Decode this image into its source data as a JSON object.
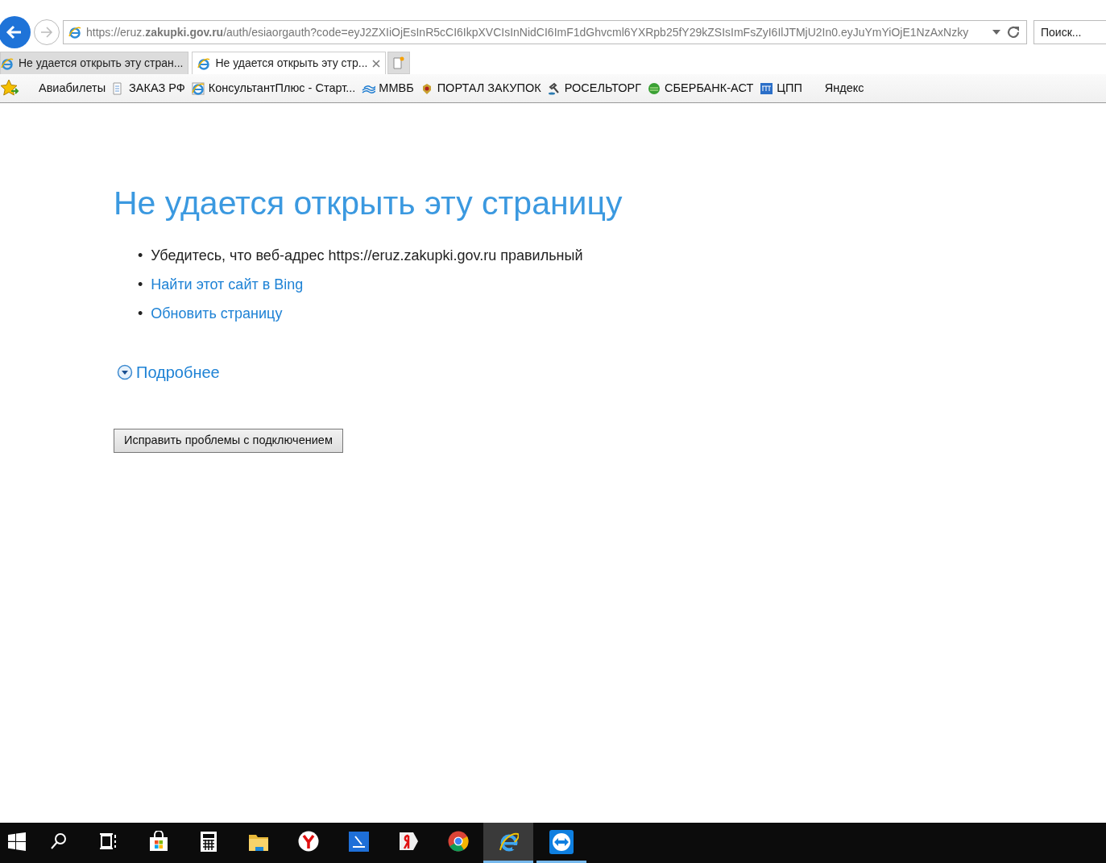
{
  "address_bar": {
    "url": "https://eruz.**zakupki.gov.ru**/auth/esiaorgauth?code=eyJ2ZXIiOjEsInR5cCI6IkpXVCIsInNidCI6ImF1dGhvcml6YXRpb25fY29kZSIsImFsZyI6IlJTMjU2In0.eyJuYmYiOjE1NzAxNzky"
  },
  "search": {
    "placeholder": "Поиск..."
  },
  "tabs": [
    {
      "label": "Не удается открыть эту стран...",
      "selected": false
    },
    {
      "label": "Не удается открыть эту стр...",
      "selected": true
    }
  ],
  "favorites": [
    {
      "label": "Авиабилеты",
      "kind": "none"
    },
    {
      "label": "ЗАКАЗ РФ",
      "kind": "page"
    },
    {
      "label": "КонсультантПлюс - Старт...",
      "kind": "ie"
    },
    {
      "label": "ММВБ",
      "kind": "waves"
    },
    {
      "label": "ПОРТАЛ ЗАКУПОК",
      "kind": "emblem"
    },
    {
      "label": "РОСЕЛЬТОРГ",
      "kind": "gavel"
    },
    {
      "label": "СБЕРБАНК-АСТ",
      "kind": "sber"
    },
    {
      "label": "ЦПП",
      "kind": "square"
    },
    {
      "label": "Яндекс",
      "kind": "none"
    }
  ],
  "error": {
    "title": "Не удается открыть эту страницу",
    "items": [
      {
        "bullet": "•",
        "text": "Убедитесь, что веб-адрес https://eruz.zakupki.gov.ru правильный",
        "kind": "text"
      },
      {
        "bullet": "•",
        "text": "Найти этот сайт в Bing",
        "kind": "link"
      },
      {
        "bullet": "•",
        "text": "Обновить страницу",
        "kind": "link"
      }
    ],
    "details": {
      "label": "Подробнее",
      "expanded": false
    },
    "fix_button": "Исправить проблемы с подключением"
  },
  "taskbar": [
    {
      "kind": "start",
      "running": false,
      "selected": false
    },
    {
      "kind": "search",
      "running": false,
      "selected": false
    },
    {
      "kind": "taskview",
      "running": false,
      "selected": false
    },
    {
      "kind": "store",
      "running": false,
      "selected": false
    },
    {
      "kind": "calculator",
      "running": false,
      "selected": false
    },
    {
      "kind": "folder",
      "running": false,
      "selected": false
    },
    {
      "kind": "yandex-browser",
      "running": false,
      "selected": false
    },
    {
      "kind": "scanner",
      "running": false,
      "selected": false
    },
    {
      "kind": "yandex",
      "running": false,
      "selected": false
    },
    {
      "kind": "chrome",
      "running": false,
      "selected": false
    },
    {
      "kind": "ie",
      "running": true,
      "selected": true
    },
    {
      "kind": "teamviewer",
      "running": true,
      "selected": false
    }
  ]
}
